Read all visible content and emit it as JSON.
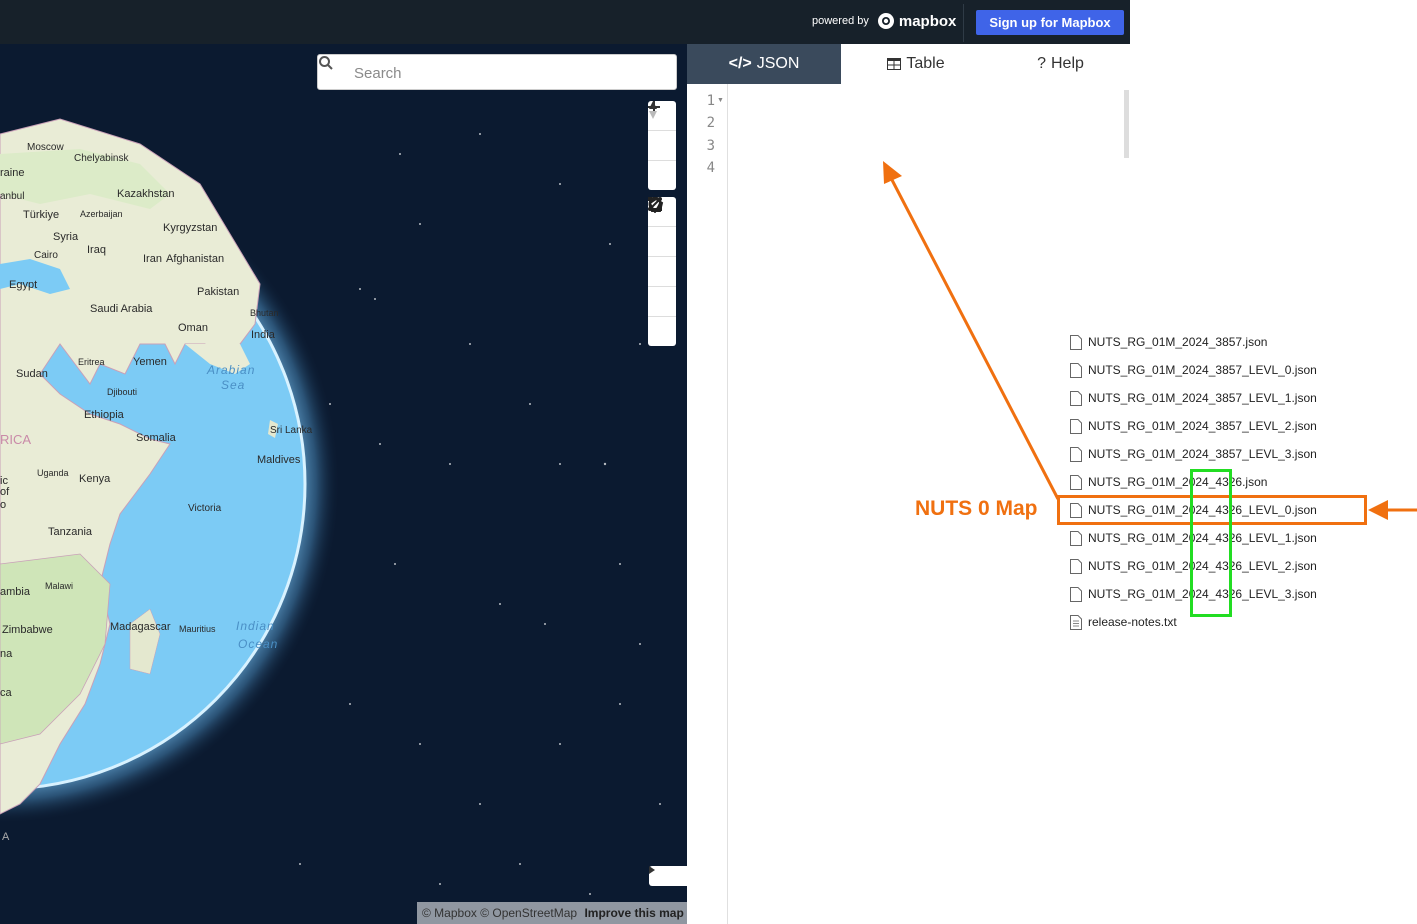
{
  "header": {
    "powered_by": "powered by",
    "brand": "mapbox",
    "signup_label": "Sign up for Mapbox"
  },
  "map": {
    "search_placeholder": "Search",
    "attribution": "© Mapbox © OpenStreetMap",
    "improve_link": "Improve this map",
    "labels": {
      "moscow": "Moscow",
      "chelyabinsk": "Chelyabinsk",
      "ukraine": "raine",
      "kazakhstan": "Kazakhstan",
      "istanbul": "anbul",
      "turkiye": "Türkiye",
      "azerbaijan": "Azerbaijan",
      "kyrgyzstan": "Kyrgyzstan",
      "syria": "Syria",
      "iraq": "Iraq",
      "cairo": "Cairo",
      "iran": "Iran",
      "afghanistan": "Afghanistan",
      "egypt": "Egypt",
      "pakistan": "Pakistan",
      "saudi": "Saudi Arabia",
      "bhutan": "Bhutan",
      "oman": "Oman",
      "india": "India",
      "eritrea": "Eritrea",
      "yemen": "Yemen",
      "sudan": "Sudan",
      "arabian1": "Arabian",
      "arabian2": "Sea",
      "djibouti": "Djibouti",
      "ethiopia": "Ethiopia",
      "africa": "RICA",
      "somalia": "Somalia",
      "srilanka": "Sri Lanka",
      "uganda": "Uganda",
      "kenya": "Kenya",
      "maldives": "Maldives",
      "ic": "ic",
      "of": "of",
      "o": "o",
      "victoria": "Victoria",
      "tanzania": "Tanzania",
      "malawi": "Malawi",
      "zambia": "ambia",
      "zimbabwe": "Zimbabwe",
      "madagascar": "Madagascar",
      "mauritius": "Mauritius",
      "indian1": "Indian",
      "indian2": "Ocean",
      "na": "na",
      "ca": "ca",
      "a": "A"
    }
  },
  "panel": {
    "tabs": [
      {
        "label": "JSON",
        "icon": "code-icon"
      },
      {
        "label": "Table",
        "icon": "table-icon"
      },
      {
        "label": "Help",
        "icon": "question-icon"
      }
    ],
    "line_numbers": [
      "1",
      "2",
      "3",
      "4"
    ]
  },
  "overlay": {
    "annotation_label": "NUTS 0 Map",
    "files": [
      "NUTS_RG_01M_2024_3857.json",
      "NUTS_RG_01M_2024_3857_LEVL_0.json",
      "NUTS_RG_01M_2024_3857_LEVL_1.json",
      "NUTS_RG_01M_2024_3857_LEVL_2.json",
      "NUTS_RG_01M_2024_3857_LEVL_3.json",
      "NUTS_RG_01M_2024_4326.json",
      "NUTS_RG_01M_2024_4326_LEVL_0.json",
      "NUTS_RG_01M_2024_4326_LEVL_1.json",
      "NUTS_RG_01M_2024_4326_LEVL_2.json",
      "NUTS_RG_01M_2024_4326_LEVL_3.json",
      "release-notes.txt"
    ],
    "colors": {
      "orange": "#f07010",
      "green": "#22dd22"
    }
  }
}
